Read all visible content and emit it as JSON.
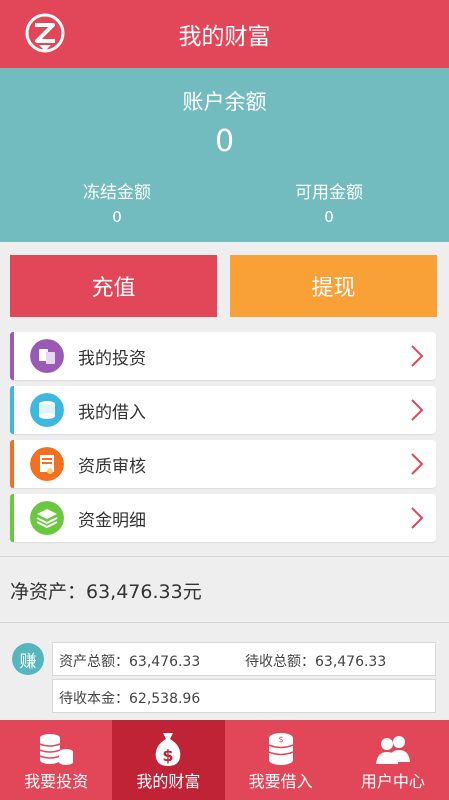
{
  "header": {
    "title": "我的财富"
  },
  "balance": {
    "label": "账户余额",
    "amount": "0",
    "frozen_label": "冻结金额",
    "frozen_value": "0",
    "available_label": "可用金额",
    "available_value": "0"
  },
  "actions": {
    "recharge": "充值",
    "withdraw": "提现"
  },
  "menu": [
    {
      "label": "我的投资",
      "icon": "documents-icon",
      "color": "#9b59b6"
    },
    {
      "label": "我的借入",
      "icon": "coins-icon",
      "color": "#3db8e0"
    },
    {
      "label": "资质审核",
      "icon": "certificate-icon",
      "color": "#f36f21"
    },
    {
      "label": "资金明细",
      "icon": "stack-icon",
      "color": "#6ac83e"
    }
  ],
  "net_assets": "净资产：63,476.33元",
  "earn": {
    "badge": "赚",
    "total_assets": "资产总额：63,476.33",
    "total_receivable": "待收总额：63,476.33",
    "principal_receivable": "待收本金：62,538.96"
  },
  "tabbar": [
    {
      "label": "我要投资",
      "icon": "coins-stack-icon"
    },
    {
      "label": "我的财富",
      "icon": "money-bag-icon",
      "active": true
    },
    {
      "label": "我要借入",
      "icon": "coin-stack-icon"
    },
    {
      "label": "用户中心",
      "icon": "users-icon"
    }
  ],
  "colors": {
    "brand_red": "#e14758",
    "teal": "#72bcbf",
    "orange": "#f9a137",
    "tab_active": "#c02335"
  }
}
